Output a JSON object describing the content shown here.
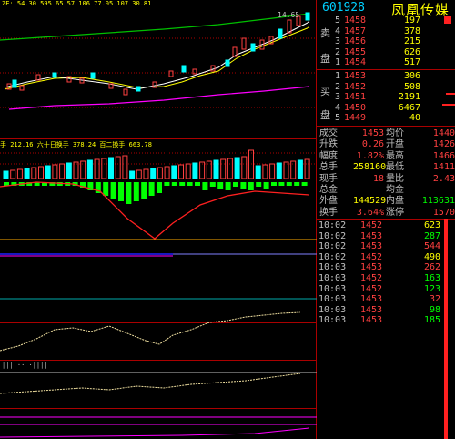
{
  "stock": {
    "code": "601928",
    "name": "凤凰传媒"
  },
  "chart_header": {
    "ma_label": "ZE: 54.30 595 65.57 106 77.05 107 30.81",
    "volume_label": "手 212.16 六十日换手 378.24 百二换手 663.78"
  },
  "price_tags": {
    "high_marker": "14.65"
  },
  "order_book": {
    "sell_label": "卖盘",
    "buy_label": "买盘",
    "asks": [
      {
        "level": "5",
        "price": "1458",
        "volume": "197"
      },
      {
        "level": "4",
        "price": "1457",
        "volume": "378"
      },
      {
        "level": "3",
        "price": "1456",
        "volume": "215"
      },
      {
        "level": "2",
        "price": "1455",
        "volume": "626"
      },
      {
        "level": "1",
        "price": "1454",
        "volume": "517"
      }
    ],
    "bids": [
      {
        "level": "1",
        "price": "1453",
        "volume": "306"
      },
      {
        "level": "2",
        "price": "1452",
        "volume": "508"
      },
      {
        "level": "3",
        "price": "1451",
        "volume": "2191"
      },
      {
        "level": "4",
        "price": "1450",
        "volume": "6467"
      },
      {
        "level": "5",
        "price": "1449",
        "volume": "40"
      }
    ]
  },
  "stats": [
    {
      "l1": "成交",
      "v1": "1453",
      "l2": "均价",
      "v2": "1440"
    },
    {
      "l1": "升跌",
      "v1": "0.26",
      "l2": "开盘",
      "v2": "1426"
    },
    {
      "l1": "幅度",
      "v1": "1.82%",
      "l2": "最高",
      "v2": "1466"
    },
    {
      "l1": "总手",
      "v1": "258160",
      "l2": "最低",
      "v2": "1411"
    },
    {
      "l1": "现手",
      "v1": "18",
      "l2": "量比",
      "v2": "2.43"
    },
    {
      "l1": "总金",
      "v1": "",
      "l2": "均金",
      "v2": ""
    },
    {
      "l1": "外盘",
      "v1": "144529",
      "l2": "内盘",
      "v2": "113631"
    },
    {
      "l1": "换手",
      "v1": "3.64%",
      "l2": "涨停",
      "v2": "1570"
    }
  ],
  "ticks": [
    {
      "time": "10:02",
      "price": "1452",
      "volume": "623",
      "vcolor": "#ffff00"
    },
    {
      "time": "10:02",
      "price": "1453",
      "volume": "287",
      "vcolor": "#00ff00"
    },
    {
      "time": "10:02",
      "price": "1453",
      "volume": "544",
      "vcolor": "#ff4040"
    },
    {
      "time": "10:02",
      "price": "1452",
      "volume": "490",
      "vcolor": "#ffff00"
    },
    {
      "time": "10:03",
      "price": "1453",
      "volume": "262",
      "vcolor": "#ff4040"
    },
    {
      "time": "10:03",
      "price": "1452",
      "volume": "163",
      "vcolor": "#00ff00"
    },
    {
      "time": "10:03",
      "price": "1452",
      "volume": "123",
      "vcolor": "#00ff00"
    },
    {
      "time": "10:03",
      "price": "1453",
      "volume": "32",
      "vcolor": "#ff4040"
    },
    {
      "time": "10:03",
      "price": "1453",
      "volume": "98",
      "vcolor": "#00ff00"
    },
    {
      "time": "10:03",
      "price": "1453",
      "volume": "185",
      "vcolor": "#00ff00"
    }
  ],
  "colors": {
    "up": "#ff4040",
    "down": "#00ffff",
    "ma_yellow": "#ffff00",
    "ma_magenta": "#ff00ff",
    "ma_green": "#00c000",
    "grid": "#aa0000"
  }
}
